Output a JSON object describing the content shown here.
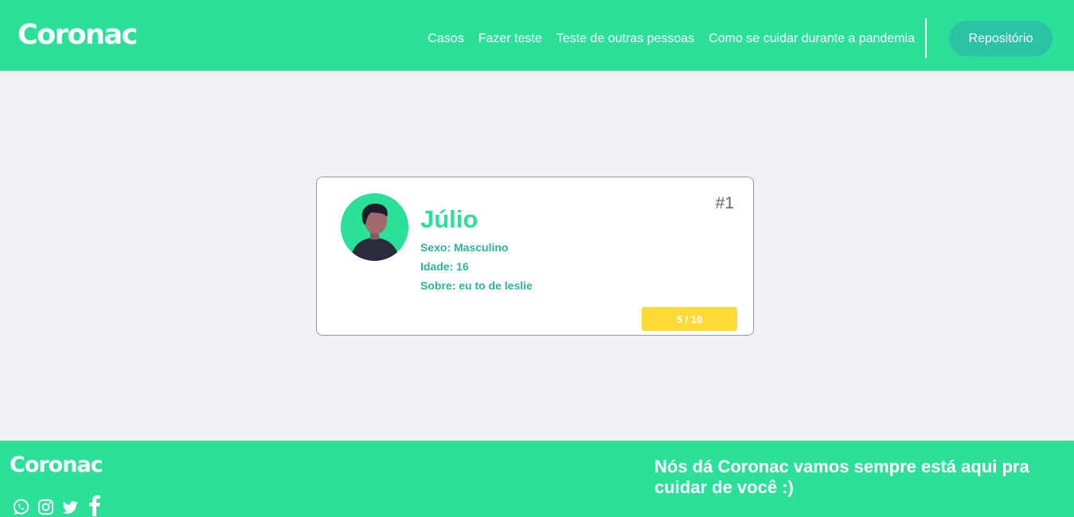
{
  "header": {
    "logo": "Coronac",
    "nav": [
      "Casos",
      "Fazer teste",
      "Teste de outras pessoas",
      "Como se cuidar durante a pandemia"
    ],
    "repo_button": "Repositório"
  },
  "card": {
    "name": "Júlio",
    "sexo": "Sexo: Masculino",
    "idade": "Idade: 16",
    "sobre": "Sobre: eu to de leslie",
    "number": "#1",
    "score": "5 / 10"
  },
  "footer": {
    "logo": "Coronac",
    "tagline": "Nós dá Coronac vamos sempre está aqui pra cuidar de você :)",
    "social": [
      "whatsapp-icon",
      "instagram-icon",
      "twitter-icon",
      "facebook-icon"
    ]
  },
  "colors": {
    "brand": "#2be098",
    "repo_button": "#2ac3a5",
    "score": "#ffdb38",
    "background": "#f0f0f5"
  }
}
